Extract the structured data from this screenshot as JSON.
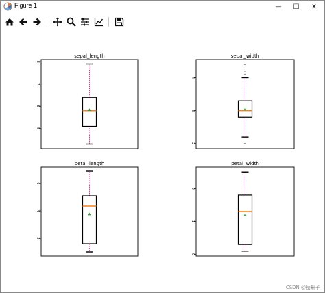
{
  "window": {
    "title": "Figure 1",
    "controls": {
      "minimize": "—",
      "maximize": "☐",
      "close": "✕"
    }
  },
  "toolbar": {
    "tools": [
      "home-icon",
      "back-arrow-icon",
      "forward-arrow-icon",
      "pan-icon",
      "zoom-icon",
      "subplots-config-icon",
      "edit-axes-icon",
      "save-icon"
    ]
  },
  "watermark": "CSDN @岳轩子",
  "style": {
    "box": "#000000",
    "median": "#ff7f0e",
    "mean": "#2ca02c",
    "whisker": "#e040c0"
  },
  "chart_data": [
    {
      "type": "box",
      "title": "sepal_length",
      "ylim": [
        4.1,
        8.1
      ],
      "yticks": [
        5,
        6,
        7,
        8
      ],
      "box": {
        "whislo": 4.3,
        "q1": 5.1,
        "med": 5.8,
        "q3": 6.4,
        "whishi": 7.9,
        "mean": 5.84
      },
      "fliers": []
    },
    {
      "type": "box",
      "title": "sepal_width",
      "ylim": [
        1.85,
        4.55
      ],
      "yticks": [
        2,
        3,
        4
      ],
      "box": {
        "whislo": 2.2,
        "q1": 2.8,
        "med": 3.0,
        "q3": 3.3,
        "whishi": 4.0,
        "mean": 3.05
      },
      "fliers": [
        2.0,
        4.1,
        4.2,
        4.4
      ]
    },
    {
      "type": "box",
      "title": "petal_length",
      "ylim": [
        0.7,
        7.2
      ],
      "yticks": [
        2,
        4,
        6
      ],
      "box": {
        "whislo": 1.0,
        "q1": 1.6,
        "med": 4.35,
        "q3": 5.1,
        "whishi": 6.9,
        "mean": 3.76
      },
      "fliers": []
    },
    {
      "type": "box",
      "title": "petal_width",
      "ylim": [
        -0.05,
        2.65
      ],
      "yticks": [
        0,
        1,
        2
      ],
      "box": {
        "whislo": 0.1,
        "q1": 0.3,
        "med": 1.3,
        "q3": 1.8,
        "whishi": 2.5,
        "mean": 1.2
      },
      "fliers": []
    }
  ]
}
